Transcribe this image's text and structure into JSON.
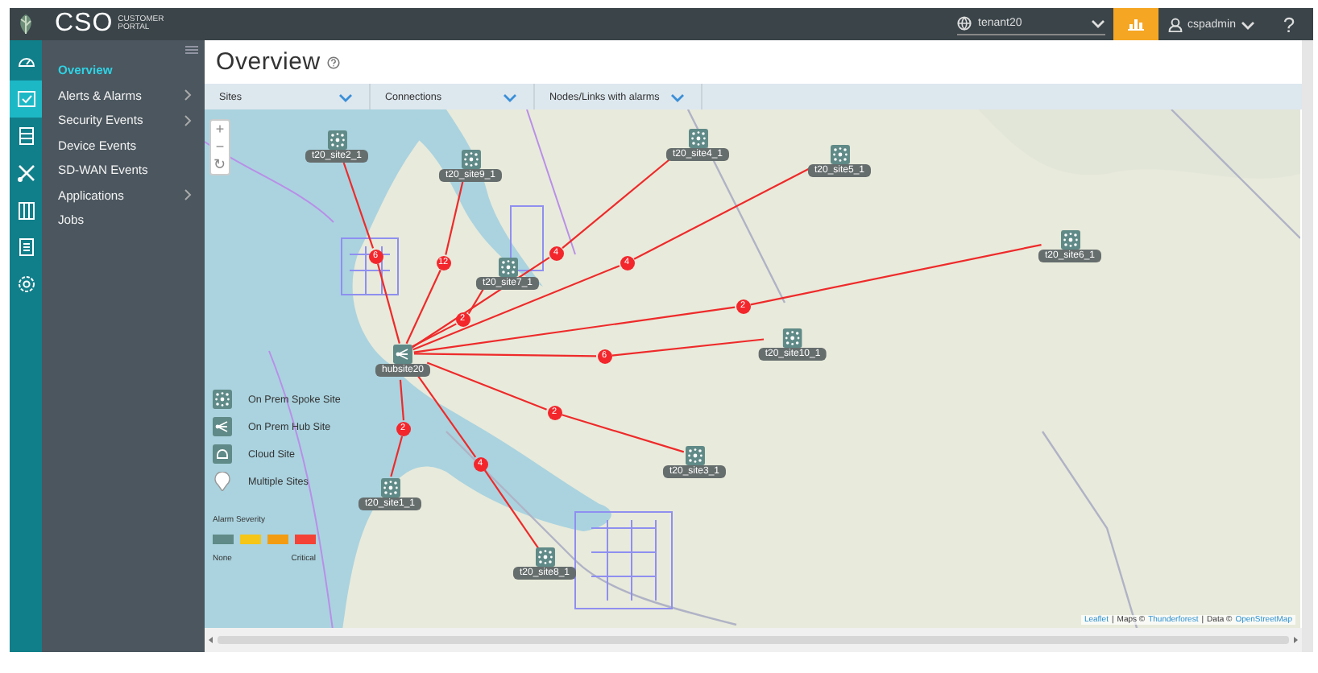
{
  "header": {
    "logo_text": "CSO",
    "logo_subtitle": [
      "CUSTOMER",
      "PORTAL"
    ],
    "tenant": "tenant20",
    "user": "cspadmin",
    "help": "?"
  },
  "icon_rail": [
    {
      "kind": "dashboard",
      "selected": false
    },
    {
      "kind": "monitor",
      "selected": true
    },
    {
      "kind": "resources",
      "selected": false
    },
    {
      "kind": "configuration",
      "selected": false
    },
    {
      "kind": "administration",
      "selected": false
    },
    {
      "kind": "reports",
      "selected": false
    },
    {
      "kind": "settings",
      "selected": false
    }
  ],
  "menu": [
    {
      "label": "Overview",
      "selected": true,
      "submenu": false
    },
    {
      "label": "Alerts & Alarms",
      "selected": false,
      "submenu": true
    },
    {
      "label": "Security Events",
      "selected": false,
      "submenu": true
    },
    {
      "label": "Device Events",
      "selected": false,
      "submenu": false
    },
    {
      "label": "SD-WAN Events",
      "selected": false,
      "submenu": false
    },
    {
      "label": "Applications",
      "selected": false,
      "submenu": true
    },
    {
      "label": "Jobs",
      "selected": false,
      "submenu": false
    }
  ],
  "page_title": "Overview",
  "filters": [
    "Sites",
    "Connections",
    "Nodes/Links with alarms"
  ],
  "map": {
    "zoom_controls": [
      "+",
      "−",
      "↻"
    ],
    "sites": [
      {
        "kind": "spoke",
        "label": "t20_site2_1",
        "alarms": "6"
      },
      {
        "kind": "spoke",
        "label": "t20_site9_1",
        "alarms": "12"
      },
      {
        "kind": "spoke",
        "label": "t20_site4_1",
        "alarms": "4"
      },
      {
        "kind": "spoke",
        "label": "t20_site5_1",
        "alarms": "4"
      },
      {
        "kind": "spoke",
        "label": "t20_site6_1",
        "alarms": "2"
      },
      {
        "kind": "spoke",
        "label": "t20_site7_1",
        "alarms": "2"
      },
      {
        "kind": "spoke",
        "label": "t20_site10_1",
        "alarms": "6"
      },
      {
        "kind": "hub",
        "label": "hubsite20"
      },
      {
        "kind": "spoke",
        "label": "t20_site3_1",
        "alarms": "2"
      },
      {
        "kind": "spoke",
        "label": "t20_site1_1",
        "alarms": "2"
      },
      {
        "kind": "spoke",
        "label": "t20_site8_1",
        "alarms": "4"
      }
    ],
    "legend": [
      {
        "kind": "spoke",
        "label": "On Prem Spoke Site"
      },
      {
        "kind": "hub",
        "label": "On Prem Hub Site"
      },
      {
        "kind": "cloud",
        "label": "Cloud Site"
      },
      {
        "kind": "multiple",
        "label": "Multiple Sites"
      }
    ],
    "severity": {
      "title": "Alarm Severity",
      "levels": [
        {
          "color": "#5f8a87"
        },
        {
          "color": "#f5c518"
        },
        {
          "color": "#f39c12"
        },
        {
          "color": "#f44336"
        }
      ],
      "low_label": "None",
      "high_label": "Critical"
    },
    "attribution": [
      {
        "kind": "link",
        "text": "Leaflet"
      },
      {
        "kind": "text",
        "text": "|"
      },
      {
        "kind": "text",
        "text": "Maps ©"
      },
      {
        "kind": "link",
        "text": "Thunderforest"
      },
      {
        "kind": "text",
        "text": "|"
      },
      {
        "kind": "text",
        "text": "Data ©"
      },
      {
        "kind": "link",
        "text": "OpenStreetMap"
      }
    ]
  }
}
